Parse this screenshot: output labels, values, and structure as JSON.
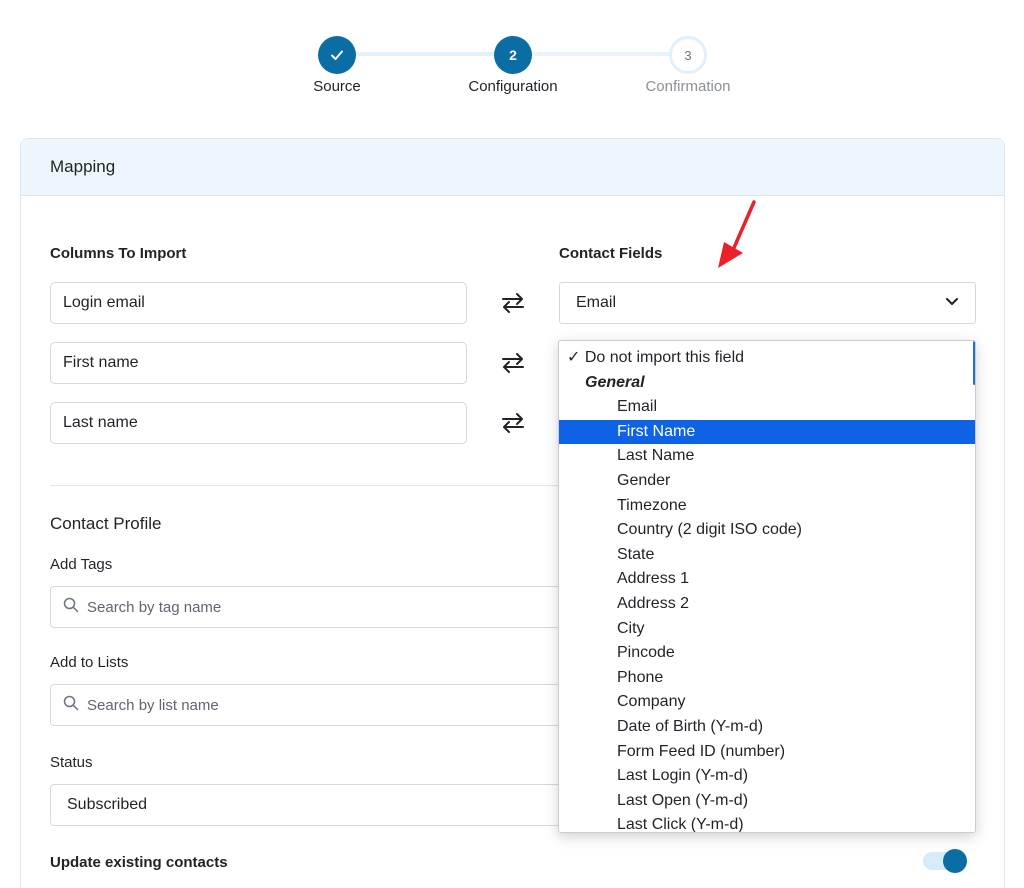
{
  "stepper": {
    "steps": [
      {
        "label": "Source",
        "state": "done",
        "icon": "check-icon"
      },
      {
        "label": "Configuration",
        "state": "active",
        "number": "2"
      },
      {
        "label": "Confirmation",
        "state": "pending",
        "number": "3"
      }
    ]
  },
  "mapping": {
    "title": "Mapping",
    "columns_heading": "Columns To Import",
    "fields_heading": "Contact Fields",
    "rows": [
      {
        "column": "Login email",
        "field": "Email"
      },
      {
        "column": "First name"
      },
      {
        "column": "Last name"
      }
    ]
  },
  "dropdown": {
    "checked_option": "✓ Do not import this field",
    "group": "General",
    "options": [
      "Email",
      "First Name",
      "Last Name",
      "Gender",
      "Timezone",
      "Country (2 digit ISO code)",
      "State",
      "Address 1",
      "Address 2",
      "City",
      "Pincode",
      "Phone",
      "Company",
      "Date of Birth (Y-m-d)",
      "Form Feed ID (number)",
      "Last Login (Y-m-d)",
      "Last Open (Y-m-d)",
      "Last Click (Y-m-d)"
    ],
    "highlighted": "First Name"
  },
  "profile": {
    "title": "Contact Profile",
    "tags_label": "Add Tags",
    "tags_placeholder": "Search by tag name",
    "lists_label": "Add to Lists",
    "lists_placeholder": "Search by list name",
    "status_label": "Status",
    "status_value": "Subscribed",
    "update_label": "Update existing contacts",
    "update_enabled": true
  },
  "colors": {
    "primary": "#0a6ea4",
    "selection": "#0d63e4",
    "header_bg": "#eef6fd",
    "annotation_arrow": "#e8212b"
  }
}
